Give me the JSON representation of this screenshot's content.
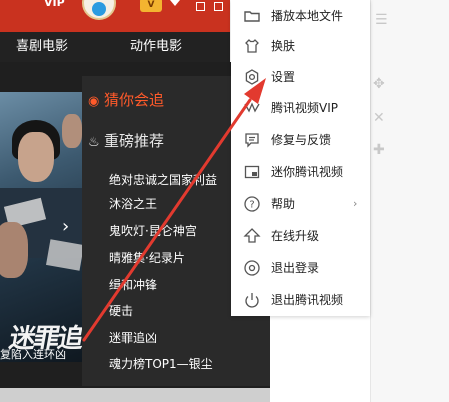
{
  "colors": {
    "accent": "#c9321f",
    "guess_accent": "#ff5a2a",
    "annotation_arrow": "#e23a2f"
  },
  "topbar": {
    "vip_text": "VIP",
    "vip_badge": "V"
  },
  "categories": [
    "喜剧电影",
    "动作电影"
  ],
  "recommend_panel": {
    "guess_title": "猜你会追",
    "recommend_title": "重磅推荐",
    "movies": [
      "绝对忠诚之国家利益",
      "沐浴之王",
      "鬼吹灯·昆仑神宫",
      "晴雅集·纪录片",
      "缉和冲锋",
      "硬击",
      "迷罪追凶",
      "魂力榜TOP1—银尘"
    ]
  },
  "poster": {
    "calligraphy": "迷罪追",
    "caption": "复陷入连环凶"
  },
  "menu": {
    "items": [
      {
        "label": "播放本地文件",
        "icon": "folder-icon"
      },
      {
        "label": "换肤",
        "icon": "shirt-icon"
      },
      {
        "label": "设置",
        "icon": "gear-icon"
      },
      {
        "label": "腾讯视频VIP",
        "icon": "vip-icon"
      },
      {
        "label": "修复与反馈",
        "icon": "feedback-icon"
      },
      {
        "label": "迷你腾讯视频",
        "icon": "mini-window-icon"
      },
      {
        "label": "帮助",
        "icon": "help-icon",
        "has_submenu": true
      },
      {
        "label": "在线升级",
        "icon": "upgrade-icon"
      },
      {
        "label": "退出登录",
        "icon": "logout-icon"
      },
      {
        "label": "退出腾讯视频",
        "icon": "power-icon"
      }
    ]
  }
}
